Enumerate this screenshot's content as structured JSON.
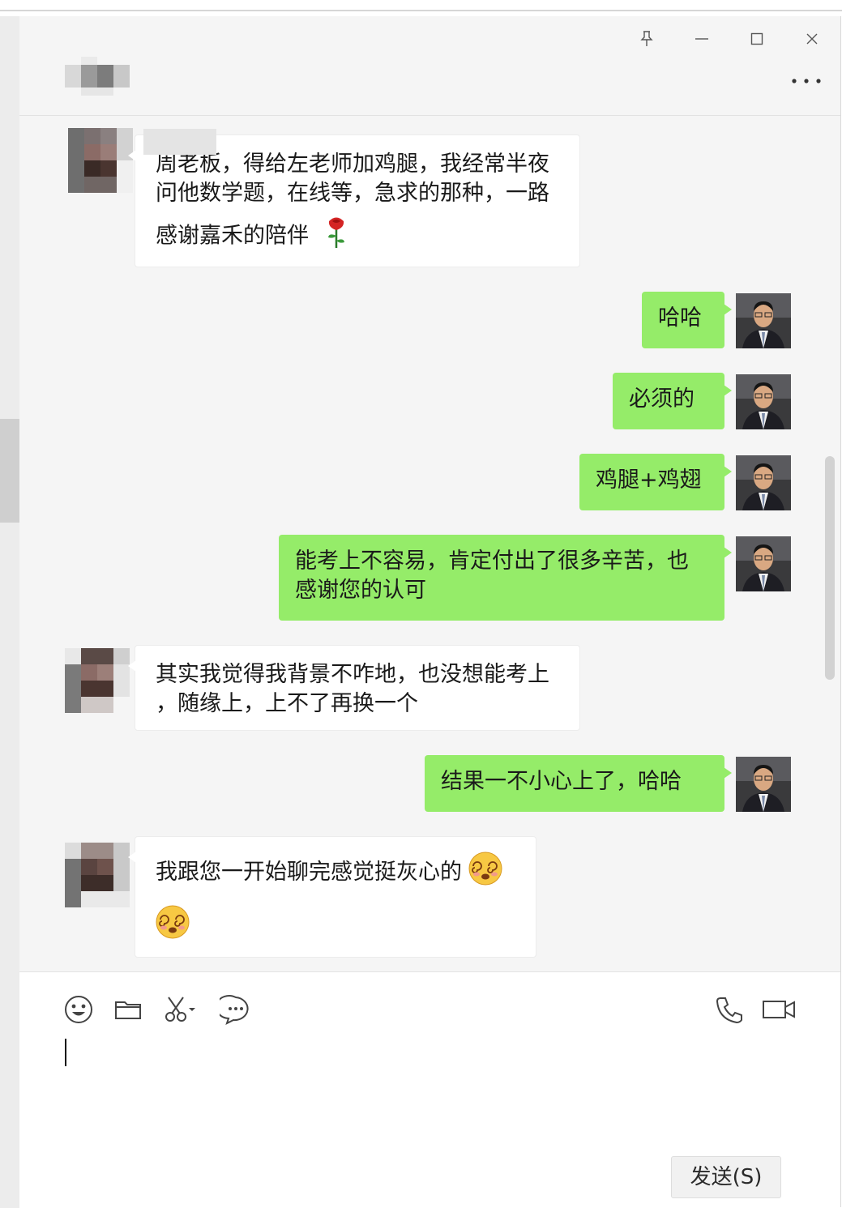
{
  "window": {
    "pin_icon": "pin-icon",
    "minimize_icon": "minimize-icon",
    "maximize_icon": "maximize-icon",
    "close_icon": "close-icon",
    "more_icon": "more-dots-icon"
  },
  "header": {
    "contact_name": ""
  },
  "colors": {
    "outgoing_bubble": "#95ec69",
    "incoming_bubble": "#ffffff",
    "background": "#f5f5f5"
  },
  "messages": [
    {
      "from": "other",
      "lines": [
        "周老板，得给左老师加鸡腿，我经常半夜",
        "问他数学题，在线等，急求的那种，一路",
        "感谢嘉禾的陪伴"
      ],
      "emoji": "rose-emoji"
    },
    {
      "from": "me",
      "lines": [
        "哈哈"
      ]
    },
    {
      "from": "me",
      "lines": [
        "必须的"
      ]
    },
    {
      "from": "me",
      "lines": [
        "鸡腿+鸡翅"
      ]
    },
    {
      "from": "me",
      "lines": [
        "能考上不容易，肯定付出了很多辛苦，也",
        "感谢您的认可"
      ]
    },
    {
      "from": "other",
      "lines": [
        "其实我觉得我背景不咋地，也没想能考上",
        "，随缘上，上不了再换一个"
      ]
    },
    {
      "from": "me",
      "lines": [
        "结果一不小心上了，哈哈"
      ]
    },
    {
      "from": "other",
      "lines": [
        "我跟您一开始聊完感觉挺灰心的"
      ],
      "emoji": "dizzy-face-emoji"
    }
  ],
  "toolbar": {
    "emoji_icon": "emoji-icon",
    "folder_icon": "folder-icon",
    "screenshot_icon": "scissors-icon",
    "chat_history_icon": "chat-bubble-icon",
    "voice_call_icon": "phone-icon",
    "video_call_icon": "video-camera-icon"
  },
  "input": {
    "value": ""
  },
  "send_button": {
    "label": "发送(S)"
  }
}
